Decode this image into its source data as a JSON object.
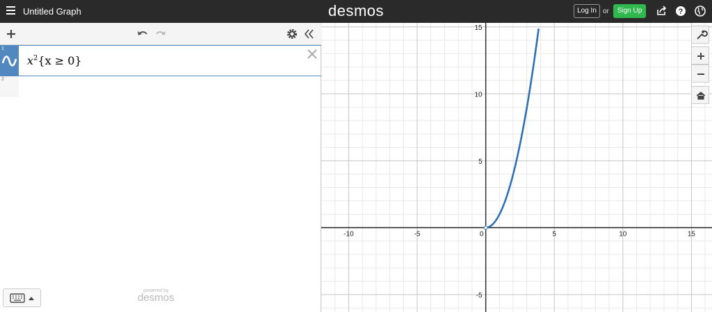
{
  "header": {
    "title": "Untitled Graph",
    "brand": "desmos",
    "login_label": "Log In",
    "or_label": "or",
    "signup_label": "Sign Up",
    "icons": [
      "menu-icon",
      "share-icon",
      "help-icon",
      "globe-icon"
    ]
  },
  "expressions": {
    "toolbar_icons": [
      "add-icon",
      "undo-icon",
      "redo-icon",
      "settings-icon",
      "collapse-icon"
    ],
    "items": [
      {
        "index": "1",
        "base": "x",
        "exponent": "2",
        "restriction": "{x ≥ 0}",
        "color": "#2d70b3"
      },
      {
        "index": "2"
      }
    ],
    "powered_by": "powered by",
    "powered_brand": "desmos"
  },
  "graph_controls": [
    "wrench-icon",
    "zoom-in-icon",
    "zoom-out-icon",
    "home-icon"
  ],
  "chart_data": {
    "type": "line",
    "title": "",
    "xlabel": "",
    "ylabel": "",
    "xlim": [
      -12,
      16.5
    ],
    "ylim": [
      -6.3,
      15.3
    ],
    "x_ticks": [
      -10,
      -5,
      0,
      5,
      10,
      15
    ],
    "y_ticks": [
      -5,
      5,
      10,
      15
    ],
    "grid": true,
    "series": [
      {
        "x": [
          0,
          0.5,
          1,
          1.5,
          2,
          2.5,
          3,
          3.5,
          3.873
        ],
        "y": [
          0,
          0.25,
          1,
          2.25,
          4,
          6.25,
          9,
          12.25,
          15
        ],
        "color": "#2d70b3"
      }
    ]
  }
}
